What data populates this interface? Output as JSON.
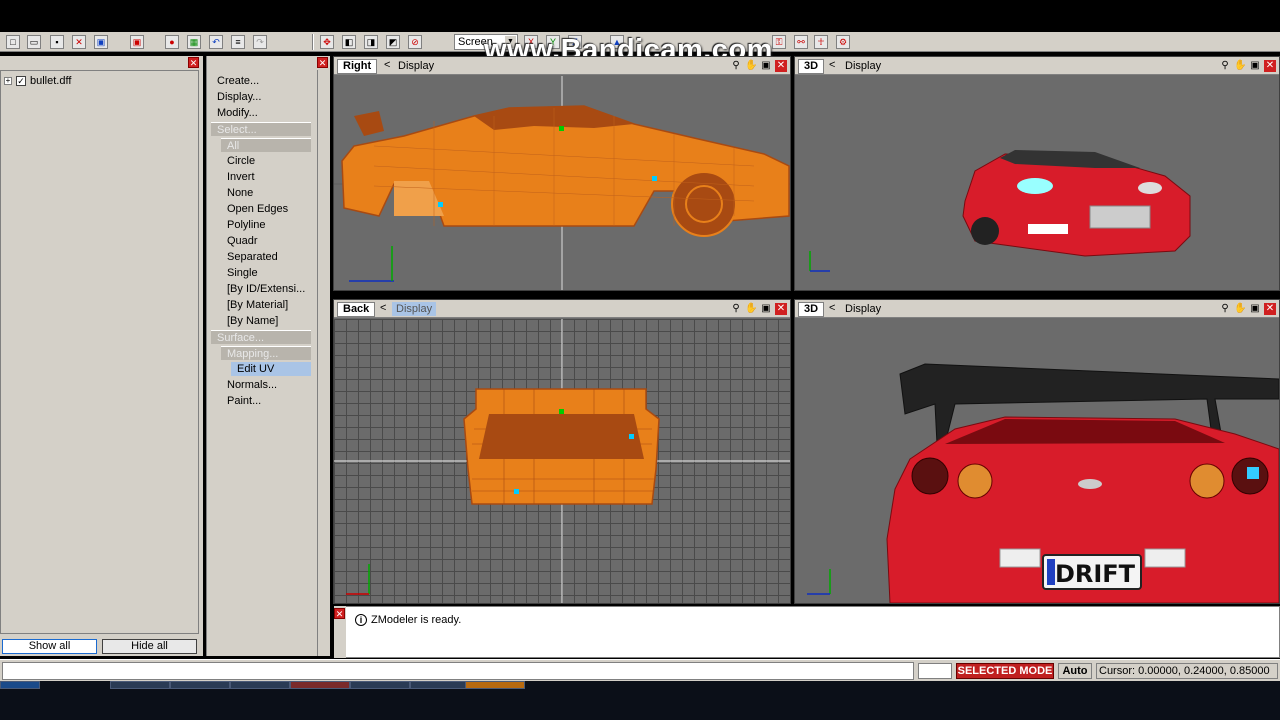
{
  "toolbar": {
    "view_mode": "Screen"
  },
  "watermark": "www.Bandicam.com",
  "tree": {
    "items": [
      {
        "label": "bullet.dff",
        "checked": true
      }
    ],
    "show_all": "Show all",
    "hide_all": "Hide all"
  },
  "commands": {
    "items": [
      {
        "label": "Create...",
        "kind": "top"
      },
      {
        "label": "Display...",
        "kind": "top"
      },
      {
        "label": "Modify...",
        "kind": "top"
      },
      {
        "label": "Select...",
        "kind": "group"
      },
      {
        "label": "All",
        "kind": "subgroup"
      },
      {
        "label": "Circle",
        "kind": "item"
      },
      {
        "label": "Invert",
        "kind": "item"
      },
      {
        "label": "None",
        "kind": "item"
      },
      {
        "label": "Open Edges",
        "kind": "item"
      },
      {
        "label": "Polyline",
        "kind": "item"
      },
      {
        "label": "Quadr",
        "kind": "item"
      },
      {
        "label": "Separated",
        "kind": "item"
      },
      {
        "label": "Single",
        "kind": "item"
      },
      {
        "label": "[By ID/Extensi...",
        "kind": "item"
      },
      {
        "label": "[By Material]",
        "kind": "item"
      },
      {
        "label": "[By Name]",
        "kind": "item"
      },
      {
        "label": "Surface...",
        "kind": "group"
      },
      {
        "label": "Mapping...",
        "kind": "subgroup"
      },
      {
        "label": "Edit UV",
        "kind": "active"
      },
      {
        "label": "Normals...",
        "kind": "item"
      },
      {
        "label": "Paint...",
        "kind": "item"
      }
    ]
  },
  "viewports": {
    "top_left": {
      "label": "Right",
      "display": "Display"
    },
    "top_right": {
      "label": "3D",
      "display": "Display"
    },
    "bottom_left": {
      "label": "Back",
      "display": "Display"
    },
    "bottom_right": {
      "label": "3D",
      "display": "Display"
    }
  },
  "plate_text": "DRIFT",
  "console": {
    "message": "ZModeler is ready."
  },
  "status": {
    "mode": "SELECTED MODE",
    "auto": "Auto",
    "cursor": "Cursor: 0.00000, 0.24000, 0.85000"
  },
  "colors": {
    "wireframe": "#e8801a",
    "wireframe_dark": "#a84a12",
    "car_red": "#d81c2a",
    "viewport_bg": "#6b6b6b",
    "selected_mode": "#c02020"
  }
}
